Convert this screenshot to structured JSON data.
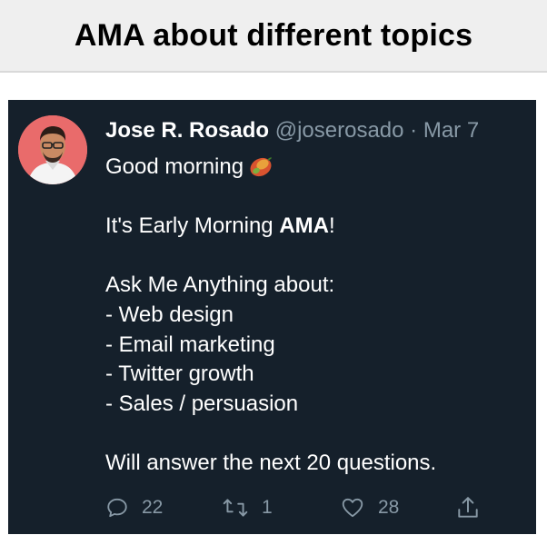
{
  "page": {
    "title": "AMA about different topics"
  },
  "tweet": {
    "author_name": "Jose R. Rosado",
    "handle": "@joserosado",
    "separator": "·",
    "date": "Mar 7",
    "body": {
      "line1": "Good morning",
      "line1_emoji": "mango-emoji",
      "line3_pre": "It's Early Morning ",
      "line3_bold": "AMA",
      "line3_post": "!",
      "line5": "Ask Me Anything about:",
      "line6": "- Web design",
      "line7": "- Email marketing",
      "line8": "- Twitter growth",
      "line9": "- Sales / persuasion",
      "line11": "Will answer the next 20 questions."
    },
    "actions": {
      "reply_icon": "reply-icon",
      "reply_count": "22",
      "retweet_icon": "retweet-icon",
      "retweet_count": "1",
      "like_icon": "heart-icon",
      "like_count": "28",
      "share_icon": "share-icon"
    }
  },
  "colors": {
    "tweet_background": "#15202b",
    "muted_text": "#8899a6",
    "header_background": "#efefef"
  }
}
